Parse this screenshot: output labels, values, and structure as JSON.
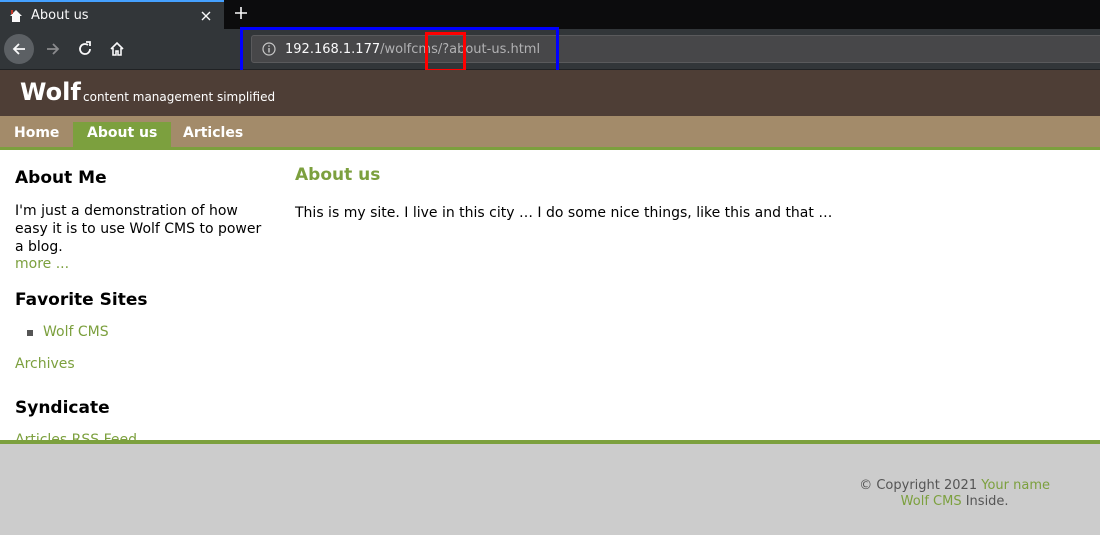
{
  "browser": {
    "tab_title": "About us",
    "url_host": "192.168.1.177",
    "url_path": "/wolfcms/?about-us.html"
  },
  "site": {
    "logo": "Wolf",
    "slogan": "content management simplified",
    "nav": [
      {
        "label": "Home"
      },
      {
        "label": "About us"
      },
      {
        "label": "Articles"
      }
    ],
    "sidebar": {
      "about_title": "About Me",
      "about_text": "I'm just a demonstration of how easy it is to use Wolf CMS to power a blog.",
      "more_link": "more ...",
      "fav_title": "Favorite Sites",
      "fav_items": [
        "Wolf CMS"
      ],
      "archives_link": "Archives",
      "synd_title": "Syndicate",
      "rss_link": "Articles RSS Feed"
    },
    "content": {
      "title": "About us",
      "body": "This is my site. I live in this city … I do some nice things, like this and that …"
    },
    "footer": {
      "copyright": "© Copyright 2021",
      "your_name": "Your name",
      "cms_link": "Wolf CMS",
      "inside": "Inside."
    }
  },
  "colors": {
    "accent": "#7ca03e",
    "header": "#4e3e36",
    "nav": "#a38b6a"
  }
}
